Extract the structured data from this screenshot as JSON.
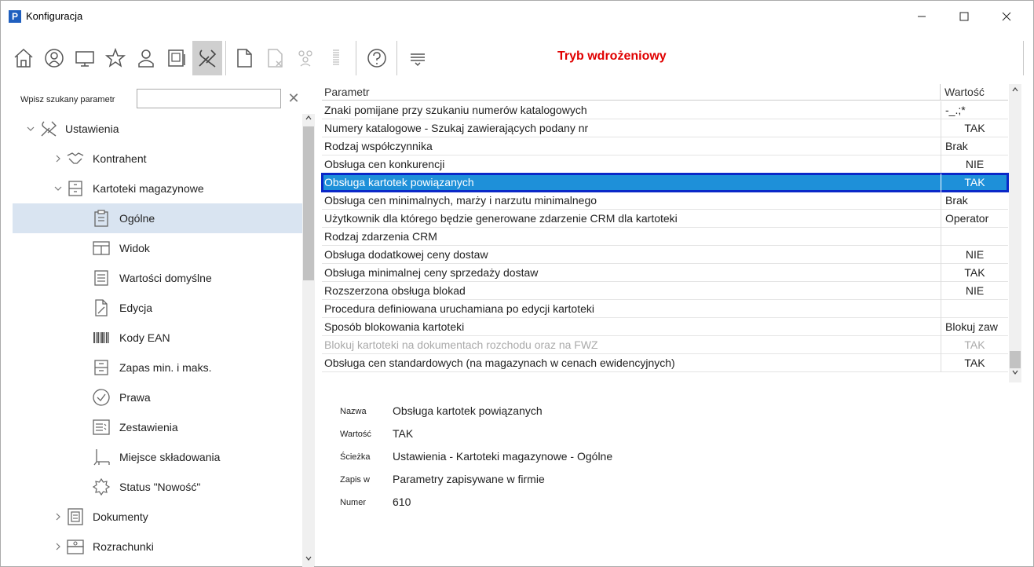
{
  "window": {
    "title": "Konfiguracja",
    "app_icon_letter": "P",
    "min": "—",
    "max": "☐",
    "close": "✕"
  },
  "toolbar": {
    "buttons": [
      {
        "name": "home-icon"
      },
      {
        "name": "user-circle-icon"
      },
      {
        "name": "monitor-icon"
      },
      {
        "name": "star-icon"
      },
      {
        "name": "user-icon"
      },
      {
        "name": "device-icon"
      },
      {
        "name": "tools-icon",
        "active": true
      },
      {
        "name": "document-icon"
      },
      {
        "name": "document-delete-icon"
      },
      {
        "name": "group-icon"
      },
      {
        "name": "barcode-icon"
      },
      {
        "name": "help-icon"
      },
      {
        "name": "filter-lines-icon"
      }
    ],
    "mode_label": "Tryb wdrożeniowy",
    "mode_color": "#e00000"
  },
  "search": {
    "label": "Wpisz szukany parametr",
    "value": "",
    "clear": "✕"
  },
  "tree": {
    "nodes": [
      {
        "label": "Ustawienia",
        "icon": "tools-icon",
        "chevron": "down"
      },
      {
        "label": "Kontrahent",
        "icon": "handshake-icon",
        "chevron": "right"
      },
      {
        "label": "Kartoteki magazynowe",
        "icon": "cabinet-icon",
        "chevron": "down"
      },
      {
        "label": "Ogólne",
        "icon": "clipboard-icon",
        "selected": true
      },
      {
        "label": "Widok",
        "icon": "window-icon"
      },
      {
        "label": "Wartości domyślne",
        "icon": "list-icon"
      },
      {
        "label": "Edycja",
        "icon": "edit-document-icon"
      },
      {
        "label": "Kody EAN",
        "icon": "barcode-icon"
      },
      {
        "label": "Zapas min. i maks.",
        "icon": "drawer-icon"
      },
      {
        "label": "Prawa",
        "icon": "check-circle-icon"
      },
      {
        "label": "Zestawienia",
        "icon": "report-icon"
      },
      {
        "label": "Miejsce składowania",
        "icon": "shelf-icon"
      },
      {
        "label": "Status \"Nowość\"",
        "icon": "badge-star-icon"
      },
      {
        "label": "Dokumenty",
        "icon": "document-box-icon",
        "chevron": "right"
      },
      {
        "label": "Rozrachunki",
        "icon": "cash-icon",
        "chevron": "right"
      }
    ]
  },
  "grid": {
    "header_param": "Parametr",
    "header_value": "Wartość",
    "rows": [
      {
        "p": "Znaki pomijane przy szukaniu numerów katalogowych",
        "v": "-_.;*",
        "align": "left"
      },
      {
        "p": "Numery katalogowe - Szukaj zawierających podany nr",
        "v": "TAK",
        "align": "center"
      },
      {
        "p": "Rodzaj współczynnika",
        "v": "Brak",
        "align": "left"
      },
      {
        "p": "Obsługa cen konkurencji",
        "v": "NIE",
        "align": "center"
      },
      {
        "p": "Obsługa kartotek powiązanych",
        "v": "TAK",
        "align": "center",
        "selected": true
      },
      {
        "p": "Obsługa cen minimalnych, marży i narzutu minimalnego",
        "v": "Brak",
        "align": "left"
      },
      {
        "p": "Użytkownik dla którego będzie generowane zdarzenie CRM dla kartoteki",
        "v": "Operator",
        "align": "left"
      },
      {
        "p": "Rodzaj zdarzenia CRM",
        "v": "",
        "align": "left"
      },
      {
        "p": "Obsługa dodatkowej ceny dostaw",
        "v": "NIE",
        "align": "center"
      },
      {
        "p": "Obsługa minimalnej ceny sprzedaży dostaw",
        "v": "TAK",
        "align": "center"
      },
      {
        "p": "Rozszerzona obsługa blokad",
        "v": "NIE",
        "align": "center"
      },
      {
        "p": "Procedura definiowana uruchamiana po edycji kartoteki",
        "v": "",
        "align": "left"
      },
      {
        "p": "Sposób blokowania kartoteki",
        "v": "Blokuj zaw",
        "align": "left"
      },
      {
        "p": "Blokuj kartoteki na dokumentach rozchodu oraz na FWZ",
        "v": "TAK",
        "align": "center",
        "disabled": true
      },
      {
        "p": "Obsługa cen standardowych (na magazynach w cenach ewidencyjnych)",
        "v": "TAK",
        "align": "center"
      }
    ]
  },
  "details": {
    "rows": [
      {
        "k": "Nazwa",
        "v": "Obsługa kartotek powiązanych"
      },
      {
        "k": "Wartość",
        "v": "TAK"
      },
      {
        "k": "Ścieżka",
        "v": "Ustawienia - Kartoteki magazynowe - Ogólne"
      },
      {
        "k": "Zapis w",
        "v": "Parametry zapisywane w firmie"
      },
      {
        "k": "Numer",
        "v": "610"
      }
    ]
  }
}
